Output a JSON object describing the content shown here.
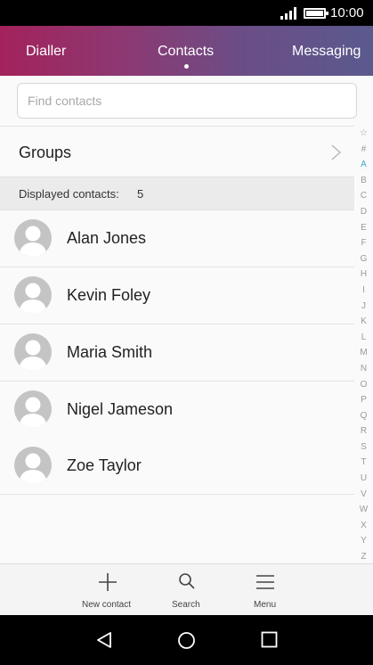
{
  "status_bar": {
    "time": "10:00",
    "signal_icon": "signal-icon",
    "battery_icon": "battery-icon"
  },
  "tabs": [
    {
      "label": "Dialler",
      "active": false
    },
    {
      "label": "Contacts",
      "active": true
    },
    {
      "label": "Messaging",
      "active": false
    }
  ],
  "search": {
    "placeholder": "Find contacts",
    "value": ""
  },
  "groups": {
    "label": "Groups",
    "icon": "chevron-right-icon"
  },
  "contacts_count": {
    "label": "Displayed contacts:",
    "value": "5"
  },
  "contacts": [
    {
      "name": "Alan Jones"
    },
    {
      "name": "Kevin Foley"
    },
    {
      "name": "Maria Smith"
    },
    {
      "name": "Nigel Jameson"
    },
    {
      "name": "Zoe Taylor"
    }
  ],
  "alphabet_index": [
    "☆",
    "#",
    "A",
    "B",
    "C",
    "D",
    "E",
    "F",
    "G",
    "H",
    "I",
    "J",
    "K",
    "L",
    "M",
    "N",
    "O",
    "P",
    "Q",
    "R",
    "S",
    "T",
    "U",
    "V",
    "W",
    "X",
    "Y",
    "Z"
  ],
  "alphabet_active": "A",
  "bottom_actions": [
    {
      "label": "New contact",
      "icon": "plus-icon"
    },
    {
      "label": "Search",
      "icon": "search-icon"
    },
    {
      "label": "Menu",
      "icon": "menu-icon"
    }
  ],
  "nav_bar": {
    "back_icon": "back-icon",
    "home_icon": "home-icon",
    "recents_icon": "recents-icon"
  },
  "colors": {
    "tab_gradient_start": "#a3225c",
    "tab_gradient_end": "#5a5a8e",
    "index_active": "#3fa9c6"
  }
}
